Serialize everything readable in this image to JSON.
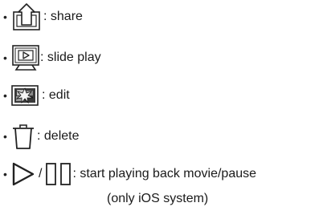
{
  "items": [
    {
      "icon": "share-icon",
      "text": " : share"
    },
    {
      "icon": "slide-play-icon",
      "text": ": slide play"
    },
    {
      "icon": "edit-icon",
      "text": " : edit"
    },
    {
      "icon": "delete-icon",
      "text": " : delete"
    },
    {
      "icon": "play-pause-icon",
      "separator": "/",
      "text": " : start playing back movie/pause",
      "note": "(only iOS system)"
    }
  ],
  "bullet": "•"
}
